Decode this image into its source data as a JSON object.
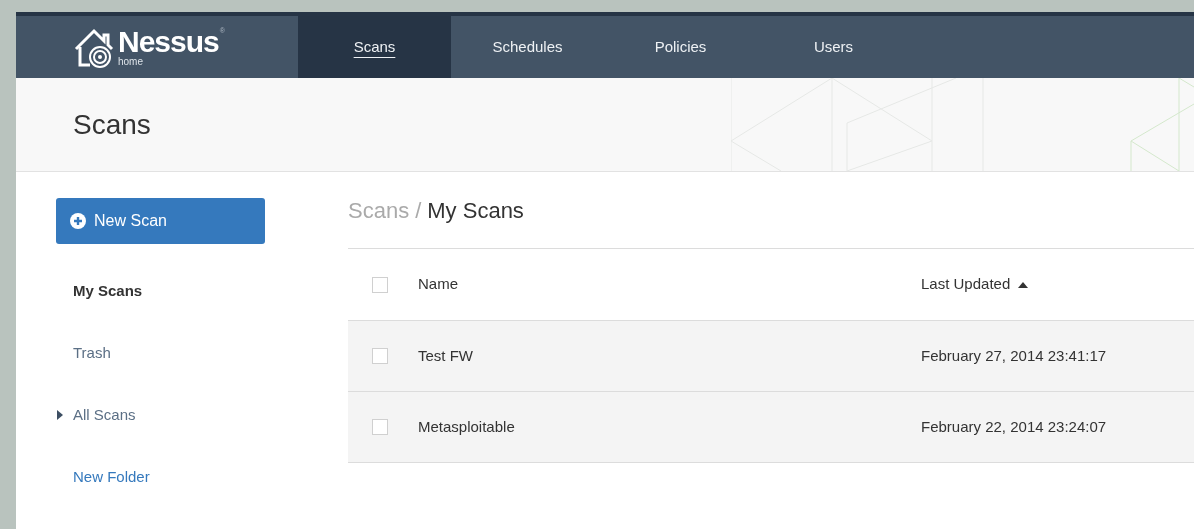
{
  "logo": {
    "name": "Nessus",
    "mark": "®",
    "edition": "home"
  },
  "tabs": [
    {
      "label": "Scans",
      "selected": true
    },
    {
      "label": "Schedules",
      "selected": false
    },
    {
      "label": "Policies",
      "selected": false
    },
    {
      "label": "Users",
      "selected": false
    }
  ],
  "page_title": "Scans",
  "new_scan_button": "New Scan",
  "sidebar": {
    "items": [
      {
        "label": "My Scans",
        "kind": "folder",
        "selected": true
      },
      {
        "label": "Trash",
        "kind": "folder",
        "selected": false
      },
      {
        "label": "All Scans",
        "kind": "group",
        "selected": false,
        "expanded": false
      },
      {
        "label": "New Folder",
        "kind": "link",
        "selected": false
      }
    ]
  },
  "breadcrumb": {
    "parent": "Scans",
    "separator": "/",
    "current": "My Scans"
  },
  "table": {
    "select_all_checked": false,
    "columns": [
      {
        "label": "Name",
        "sorted": false
      },
      {
        "label": "Last Updated",
        "sorted": true
      }
    ],
    "rows": [
      {
        "checked": false,
        "cells": [
          "Test FW",
          "February 27, 2014 23:41:17"
        ]
      },
      {
        "checked": false,
        "cells": [
          "Metasploitable",
          "February 22, 2014 23:24:07"
        ]
      }
    ]
  }
}
